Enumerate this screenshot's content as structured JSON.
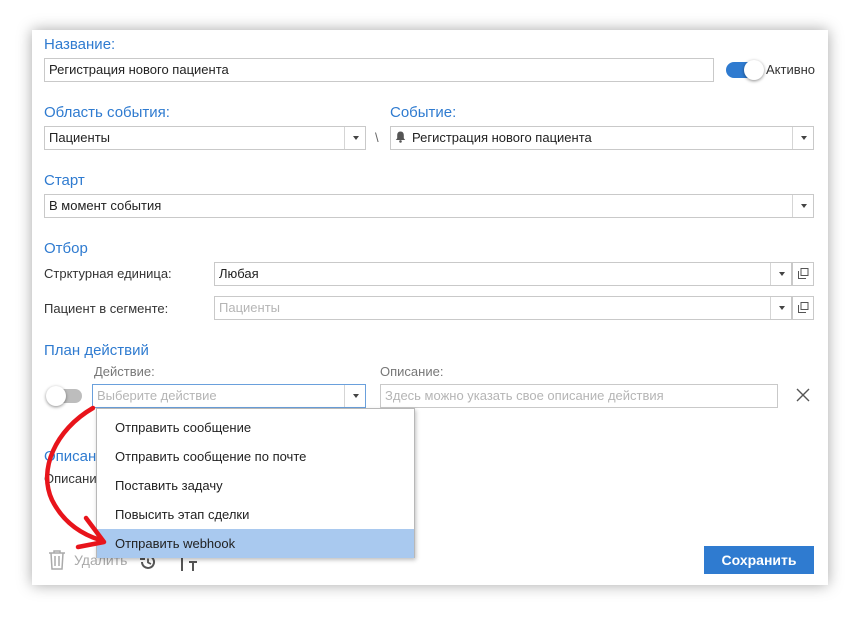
{
  "form": {
    "name_label": "Название:",
    "name_value": "Регистрация нового пациента",
    "active_label": "Активно",
    "event_area_label": "Область события:",
    "event_area_value": "Пациенты",
    "separator": "\\",
    "event_label": "Событие:",
    "event_value": "Регистрация нового пациента",
    "start_label": "Старт",
    "start_value": "В момент события",
    "filter_label": "Отбор",
    "unit_label": "Стрктурная единица:",
    "unit_value": "Любая",
    "segment_label": "Пациент в сегменте:",
    "segment_placeholder": "Пациенты",
    "plan_label": "План действий",
    "action_label": "Действие:",
    "action_placeholder": "Выберите действие",
    "desc_label": "Описание:",
    "desc_placeholder": "Здесь можно указать свое описание действия",
    "description_section_label": "Описание",
    "description_sub_label": "Описание"
  },
  "dropdown": {
    "items": [
      "Отправить сообщение",
      "Отправить сообщение по почте",
      "Поставить задачу",
      "Повысить этап сделки",
      "Отправить webhook"
    ],
    "selected": "Отправить webhook"
  },
  "footer": {
    "delete_label": "Удалить",
    "save_label": "Сохранить"
  },
  "colors": {
    "accent": "#2f7bd0",
    "highlight": "#a9c9ef",
    "arrow": "#e8141b"
  },
  "icons": {
    "bell": "bell-icon",
    "close": "close-icon",
    "trash": "trash-icon",
    "history": "history-icon",
    "text_size": "text-size-icon",
    "open_external": "open-external-icon"
  }
}
